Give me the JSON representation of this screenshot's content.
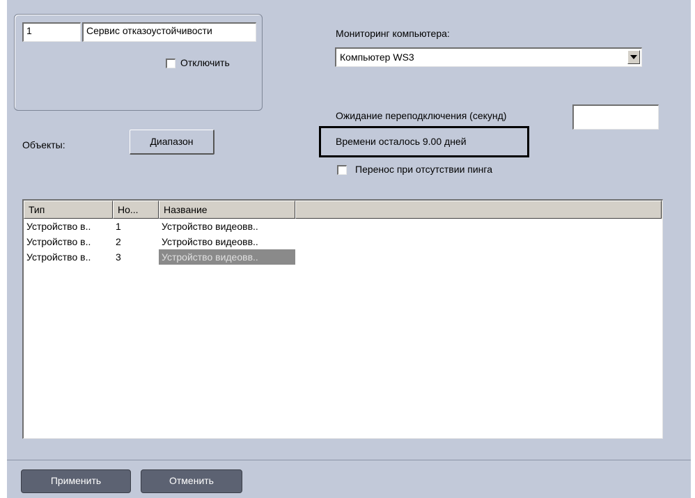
{
  "header": {
    "id_value": "1",
    "name_value": "Сервис отказоустойчивости",
    "disable_label": "Отключить"
  },
  "monitoring": {
    "label": "Мониторинг компьютера:",
    "selected": "Компьютер WS3",
    "reconnect_label": "Ожидание переподключения (секунд)",
    "reconnect_value": "",
    "time_left": "Времени осталось 9.00 дней",
    "ping_label": "Перенос при отсутствии пинга"
  },
  "objects": {
    "label": "Объекты:",
    "range_button": "Диапазон"
  },
  "table": {
    "columns": [
      "Тип",
      "Но...",
      "Название"
    ],
    "rows": [
      {
        "type": "Устройство в..",
        "num": "1",
        "name": "Устройство видеовв.."
      },
      {
        "type": "Устройство в..",
        "num": "2",
        "name": "Устройство видеовв.."
      },
      {
        "type": "Устройство в..",
        "num": "3",
        "name": "Устройство видеовв.."
      }
    ],
    "selected_row": 2
  },
  "footer": {
    "apply_label": "Применить",
    "cancel_label": "Отменить"
  },
  "icons": {
    "dropdown": "chevron-down-icon"
  },
  "colors": {
    "panel_bg": "#c2c9d9",
    "selection_bg": "#8a8a8a",
    "footer_button_bg": "#5c6272"
  }
}
